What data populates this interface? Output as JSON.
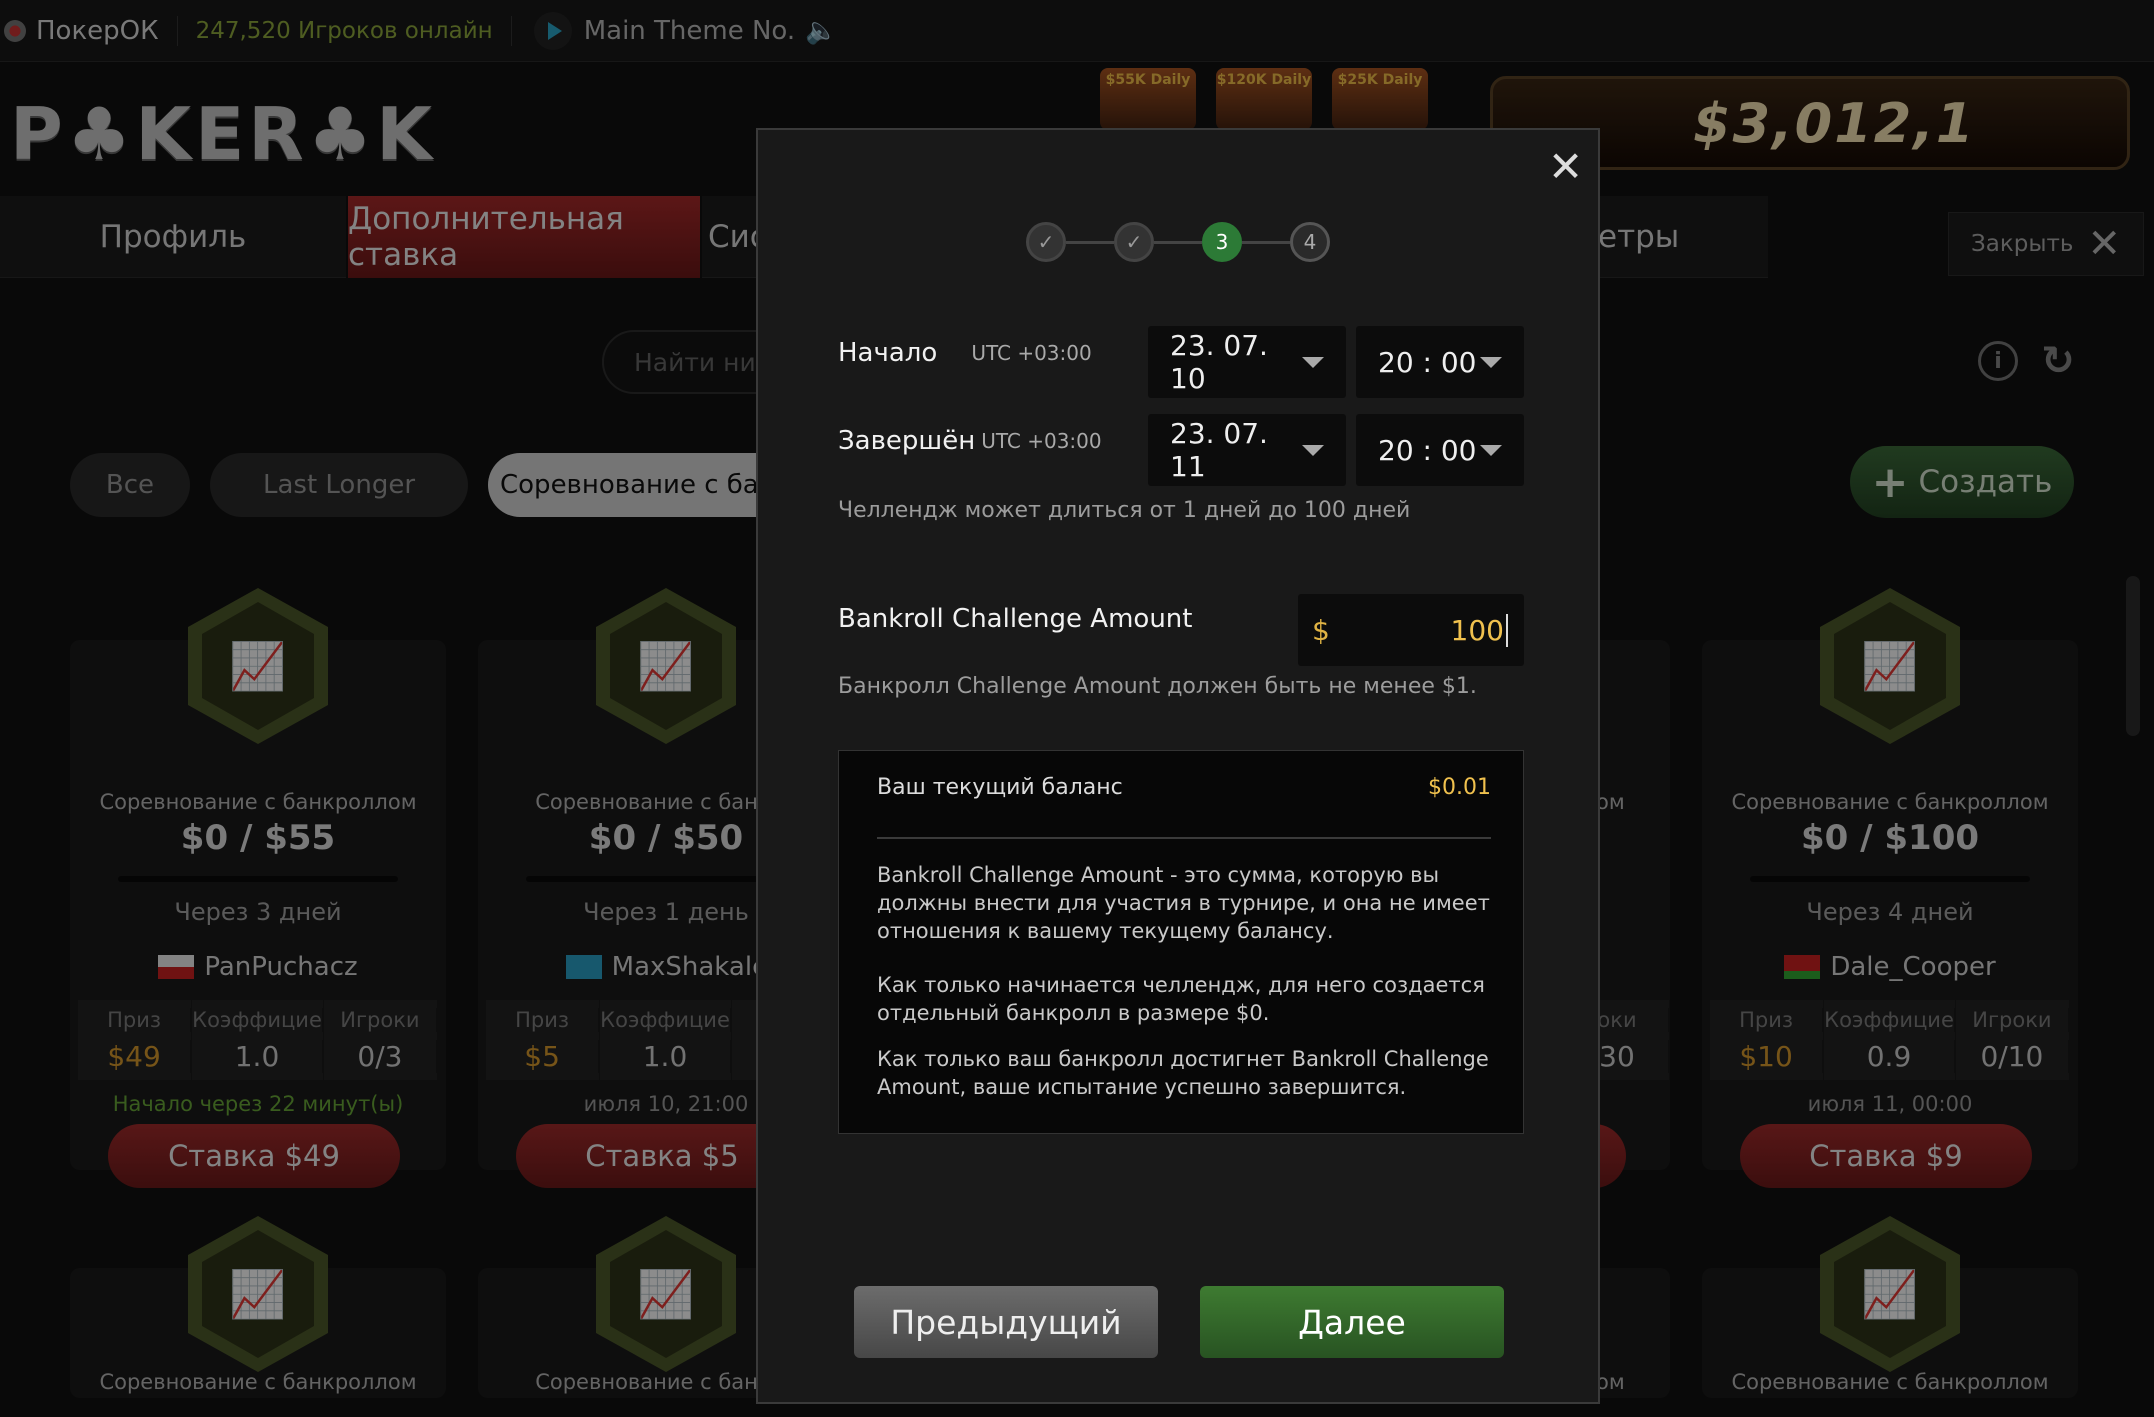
{
  "topbar": {
    "app_title": "ПокерОК",
    "online": "247,520 Игроков онлайн",
    "track": "Main Theme No."
  },
  "brand": {
    "logo_text": "P♣KER♣K",
    "badges": [
      "$55K Daily",
      "$120K Daily",
      "$25K Daily"
    ],
    "jackpot": "$3,012,1"
  },
  "nav": {
    "tabs": [
      "Профиль",
      "Дополнительная ставка",
      "Сис",
      "етры"
    ],
    "close_label": "Закрыть"
  },
  "search": {
    "placeholder": "Найти ник"
  },
  "filters": [
    "Все",
    "Last Longer",
    "Соревнование с бан"
  ],
  "create_label": "Создать",
  "cards": [
    {
      "title": "Соревнование с банкроллом",
      "amount": "$0 / $55",
      "ends": "Через 3 дней",
      "owner": "PanPuchacz",
      "prize_label": "Приз",
      "prize": "$49",
      "coef_label": "Коэффицие",
      "coef": "1.0",
      "players_label": "Игроки",
      "players": "0/3",
      "start": "Начало через 22 минут(ы)",
      "bet": "Ставка $49"
    },
    {
      "title": "Соревнование с банкро",
      "amount": "$0 / $50",
      "ends": "Через 1 день",
      "owner": "MaxShakalc",
      "prize_label": "Приз",
      "prize": "$5",
      "coef_label": "Коэффицие",
      "coef": "1.0",
      "players_label": "",
      "players": "",
      "start": "июля 10, 21:00",
      "bet": "Ставка $5"
    },
    {
      "title": "Соревнование с банкроллом",
      "amount": "$0 / $100",
      "ends": "Через 4 дней",
      "owner": "Dale_Cooper",
      "prize_label": "Приз",
      "prize": "$10",
      "coef_label": "Коэффицие",
      "coef": "0.9",
      "players_label": "Игроки",
      "players": "0/10",
      "start": "июля 11, 00:00",
      "bet": "Ставка $9"
    }
  ],
  "hidden_card_fragments": {
    "title": "ом",
    "players_label": "оки",
    "players": "30"
  },
  "bottom_card_titles": [
    "Соревнование с банкроллом",
    "Соревнование с банкро",
    "ом",
    "Соревнование с банкроллом"
  ],
  "modal": {
    "steps": [
      "✓",
      "✓",
      "3",
      "4"
    ],
    "start_label": "Начало",
    "end_label": "Завершён",
    "tz": "UTC +03:00",
    "start_date": "23. 07. 10",
    "start_time": "20 : 00",
    "end_date": "23. 07. 11",
    "end_time": "20 : 00",
    "duration_hint": "Челлендж может длиться от 1 дней до 100 дней",
    "amount_label": "Bankroll Challenge Amount",
    "currency": "$",
    "amount_value": "100",
    "amount_hint": "Банкролл Challenge Amount должен быть не менее $1.",
    "balance_label": "Ваш текущий баланс",
    "balance_value": "$0.01",
    "info_paragraphs": [
      "Bankroll Challenge Amount - это сумма, которую вы должны внести для участия в турнире, и она не имеет отношения к вашему текущему балансу.",
      "Как только начинается челлендж, для него создается отдельный банкролл в размере $0.",
      "Как только ваш банкролл достигнет Bankroll Challenge Amount, ваше испытание успешно завершится."
    ],
    "prev_label": "Предыдущий",
    "next_label": "Далее"
  },
  "colors": {
    "accent_green": "#2c7a36",
    "accent_red": "#a82a2a",
    "gold": "#f0c14e"
  }
}
